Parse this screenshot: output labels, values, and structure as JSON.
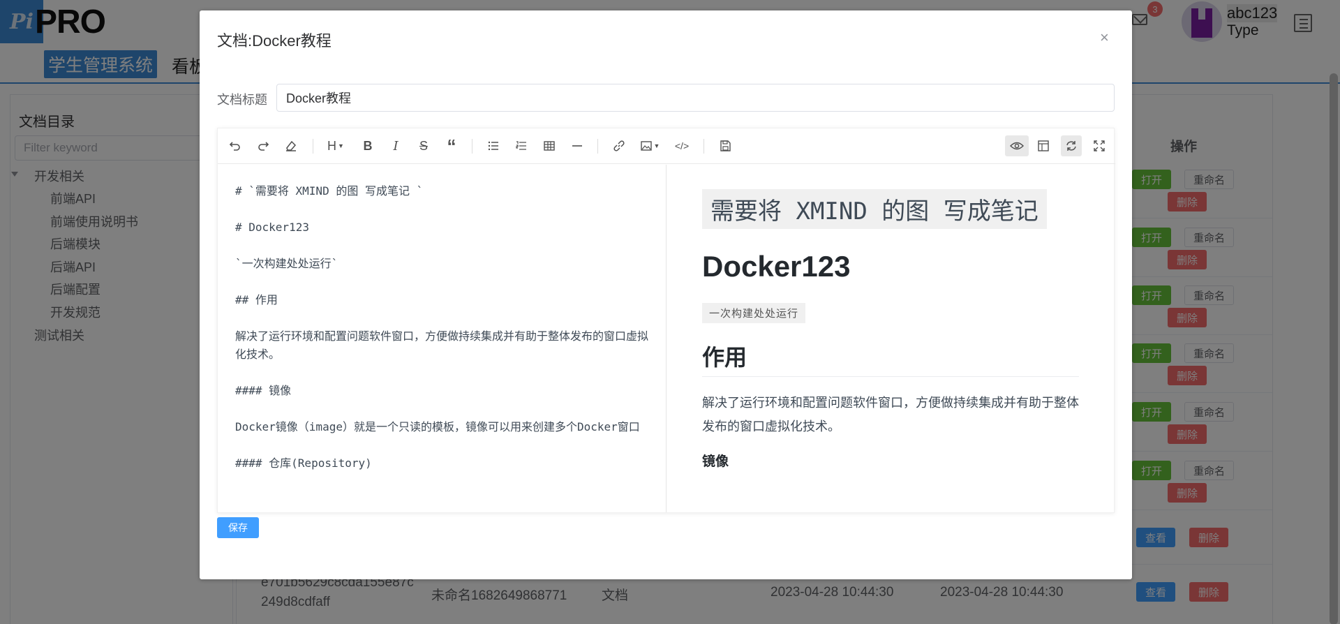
{
  "app": {
    "logo_mark": "Pi",
    "logo_text": "PRO",
    "mail_badge": "3",
    "user_name": "abc123",
    "user_type": "Type"
  },
  "nav": {
    "active": "学生管理系统",
    "next": "看板"
  },
  "sidebar": {
    "title": "文档目录",
    "filter_placeholder": "Filter keyword",
    "tree": [
      {
        "label": "开发相关"
      },
      {
        "label": "前端API"
      },
      {
        "label": "前端使用说明书"
      },
      {
        "label": "后端模块"
      },
      {
        "label": "后端API"
      },
      {
        "label": "后端配置"
      },
      {
        "label": "开发规范"
      },
      {
        "label": "测试相关"
      }
    ]
  },
  "table": {
    "op_header": "操作",
    "btn_open": "打开",
    "btn_rename": "重命名",
    "btn_delete": "删除",
    "btn_view": "查看",
    "last_row": {
      "id_line1": "e701b5629c8cda155e87c",
      "id_line2": "249d8cdfaff",
      "name": "未命名1682649868771",
      "type": "文档",
      "created": "2023-04-28 10:44:30",
      "updated": "2023-04-28 10:44:30"
    }
  },
  "dialog": {
    "title": "文档:Docker教程",
    "close": "×",
    "label_title": "文档标题",
    "title_value": "Docker教程",
    "save": "保存"
  },
  "editor": {
    "source_lines": [
      "# `需要将 XMIND 的图 写成笔记 `",
      "",
      "# Docker123",
      "",
      "`一次构建处处运行`",
      "",
      "## 作用",
      "",
      "解决了运行环境和配置问题软件窗口，方便做持续集成并有助于整体发布的窗口虚拟化技术。",
      "",
      "#### 镜像",
      "",
      "Docker镜像（image）就是一个只读的模板，镜像可以用来创建多个Docker窗口",
      "",
      "#### 仓库(Repository)"
    ],
    "preview": {
      "h1_code": "需要将 XMIND 的图 写成笔记",
      "h1": "Docker123",
      "inline_code": "一次构建处处运行",
      "h2": "作用",
      "p1": "解决了运行环境和配置问题软件窗口，方便做持续集成并有助于整体发布的窗口虚拟化技术。",
      "h4": "镜像"
    }
  }
}
